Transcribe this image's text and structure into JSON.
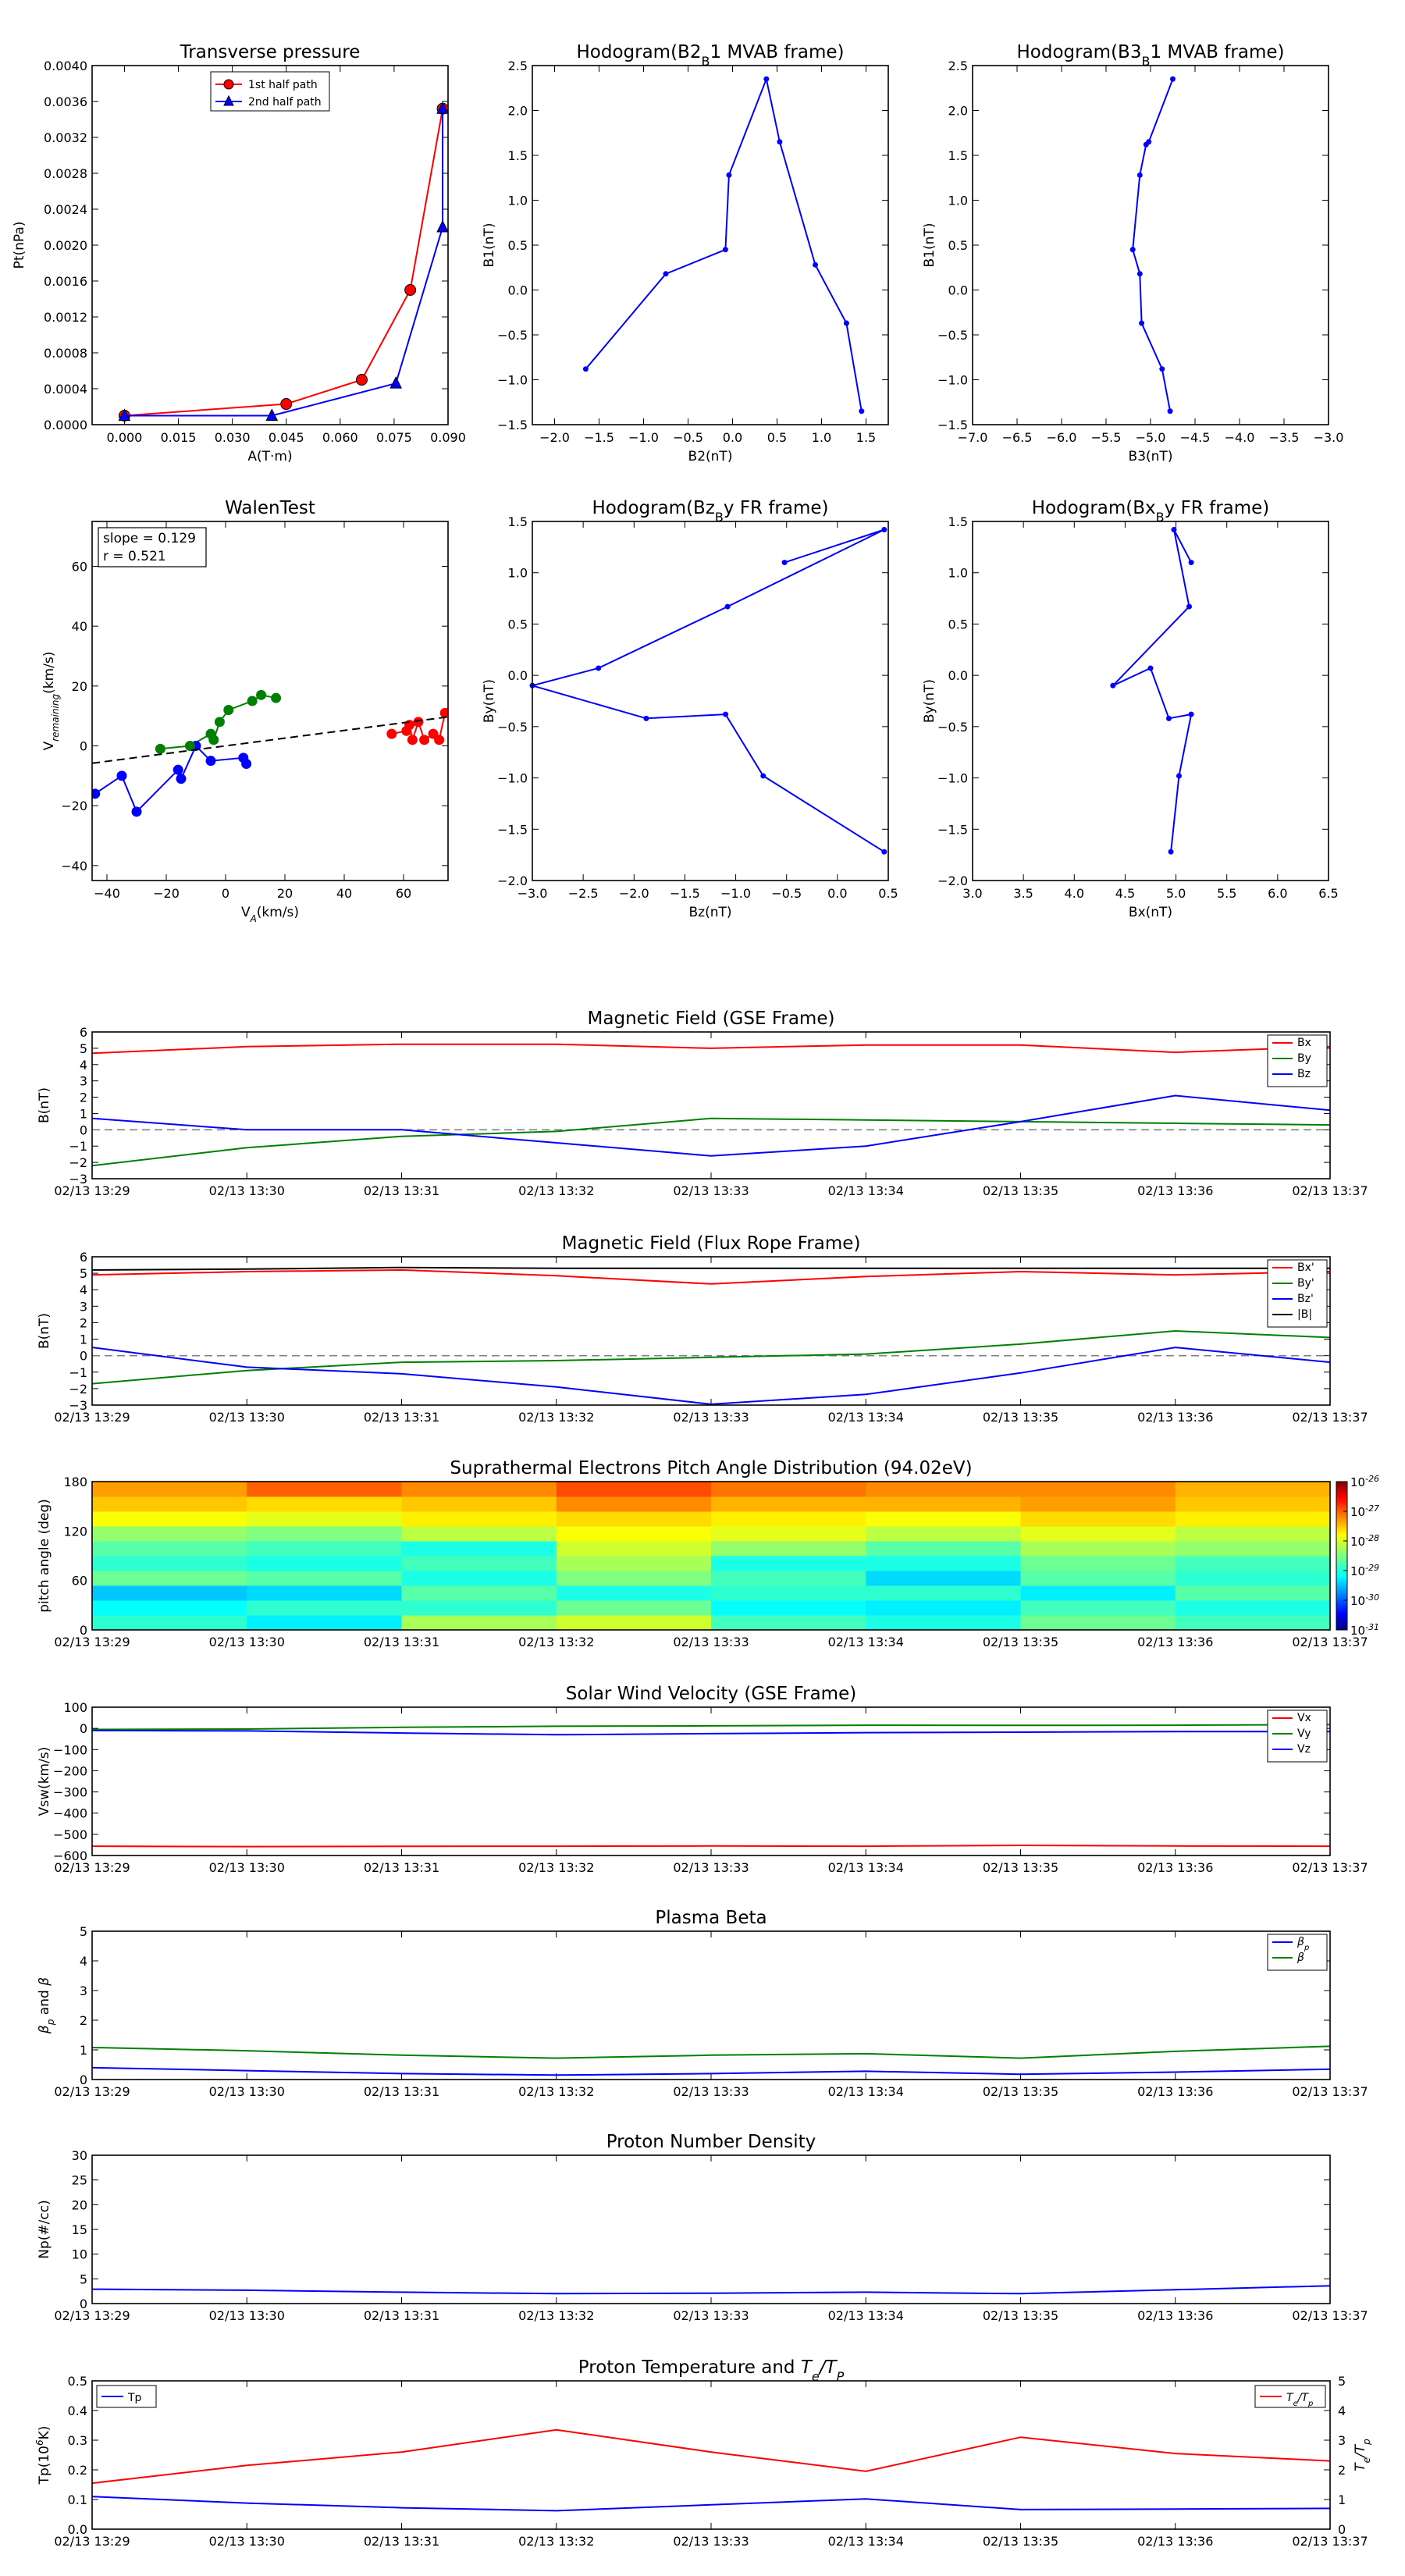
{
  "times": [
    "02/13 13:29",
    "02/13 13:30",
    "02/13 13:31",
    "02/13 13:32",
    "02/13 13:33",
    "02/13 13:34",
    "02/13 13:35",
    "02/13 13:36",
    "02/13 13:37"
  ],
  "colors": {
    "red": "#ff0000",
    "green": "#008000",
    "blue": "#0000ff",
    "black": "#000000",
    "gray": "#808080"
  },
  "chart_data": [
    {
      "id": "pt",
      "type": "line",
      "title": "Transverse pressure",
      "xlabel": "A(T·m)",
      "ylabel": "Pt(nPa)",
      "xlim": [
        -0.009,
        0.09
      ],
      "ylim": [
        0,
        0.004
      ],
      "xticks": [
        "0.000",
        "0.015",
        "0.030",
        "0.045",
        "0.060",
        "0.075",
        "0.090"
      ],
      "yticks": [
        "0.0000",
        "0.0004",
        "0.0008",
        "0.0012",
        "0.0016",
        "0.0020",
        "0.0024",
        "0.0028",
        "0.0032",
        "0.0036",
        "0.0040"
      ],
      "legend": {
        "position": "top-center",
        "entries": [
          "1st half path",
          "2nd half path"
        ]
      },
      "series": [
        {
          "name": "1st half path",
          "color": "red",
          "marker": "circle",
          "x": [
            0.0,
            0.045,
            0.066,
            0.0795,
            0.0885
          ],
          "y": [
            0.0001,
            0.00023,
            0.0005,
            0.0015,
            0.00352
          ]
        },
        {
          "name": "2nd half path",
          "color": "blue",
          "marker": "triangle",
          "x": [
            0.0,
            0.041,
            0.0755,
            0.0885,
            0.0885
          ],
          "y": [
            0.0001,
            0.0001,
            0.00046,
            0.0022,
            0.00352
          ]
        }
      ]
    },
    {
      "id": "h1",
      "type": "line",
      "title": "Hodogram(B2_B1 MVAB frame)",
      "xlabel": "B2(nT)",
      "ylabel": "B1(nT)",
      "xlim": [
        -2.25,
        1.75
      ],
      "ylim": [
        -1.5,
        2.5
      ],
      "xticks": [
        "−2.0",
        "−1.5",
        "−1.0",
        "−0.5",
        "0.0",
        "0.5",
        "1.0",
        "1.5"
      ],
      "yticks": [
        "−1.5",
        "−1.0",
        "−0.5",
        "0.0",
        "0.5",
        "1.0",
        "1.5",
        "2.0",
        "2.5"
      ],
      "series": [
        {
          "color": "blue",
          "marker": "dot",
          "x": [
            -1.65,
            -0.75,
            -0.08,
            -0.04,
            0.38,
            0.53,
            0.93,
            1.28,
            1.45
          ],
          "y": [
            -0.88,
            0.18,
            0.45,
            1.28,
            2.35,
            1.65,
            0.28,
            -0.37,
            -1.35
          ]
        }
      ]
    },
    {
      "id": "h2",
      "type": "line",
      "title": "Hodogram(B3_B1 MVAB frame)",
      "xlabel": "B3(nT)",
      "ylabel": "B1(nT)",
      "xlim": [
        -7.0,
        -3.0
      ],
      "ylim": [
        -1.5,
        2.5
      ],
      "xticks": [
        "−7.0",
        "−6.5",
        "−6.0",
        "−5.5",
        "−5.0",
        "−4.5",
        "−4.0",
        "−3.5",
        "−3.0"
      ],
      "yticks": [
        "−1.5",
        "−1.0",
        "−0.5",
        "0.0",
        "0.5",
        "1.0",
        "1.5",
        "2.0",
        "2.5"
      ],
      "series": [
        {
          "color": "blue",
          "marker": "dot",
          "x": [
            -4.78,
            -4.87,
            -5.1,
            -5.12,
            -5.2,
            -5.12,
            -5.05,
            -5.02,
            -4.75
          ],
          "y": [
            -1.35,
            -0.88,
            -0.37,
            0.18,
            0.45,
            1.28,
            1.62,
            1.65,
            2.35
          ]
        }
      ]
    },
    {
      "id": "walen",
      "type": "scatter",
      "title": "WalenTest",
      "xlabel": "V$_A$(km/s)",
      "ylabel": "V$_{remaining}$(km/s)",
      "xlim": [
        -45,
        75
      ],
      "ylim": [
        -45,
        75
      ],
      "xticks": [
        "−40",
        "−20",
        "0",
        "20",
        "40",
        "60"
      ],
      "yticks": [
        "−40",
        "−20",
        "0",
        "20",
        "40",
        "60"
      ],
      "annotation": [
        "slope = 0.129",
        "r = 0.521"
      ],
      "fit": {
        "slope": 0.129,
        "intercept": 0.0
      },
      "series": [
        {
          "color": "blue",
          "x": [
            -44,
            -35,
            -30,
            -16,
            -15,
            -10,
            -5,
            6,
            7
          ],
          "y": [
            -16,
            -10,
            -22,
            -8,
            -11,
            0,
            -5,
            -4,
            -6
          ]
        },
        {
          "color": "green",
          "x": [
            -22,
            -12,
            -5,
            -4,
            -2,
            1,
            9,
            12,
            17
          ],
          "y": [
            -1,
            0,
            4,
            2,
            8,
            12,
            15,
            17,
            16
          ]
        },
        {
          "color": "red",
          "x": [
            56,
            61,
            62,
            63,
            65,
            67,
            70,
            72,
            74
          ],
          "y": [
            4,
            5,
            7,
            2,
            8,
            2,
            4,
            2,
            11
          ]
        }
      ]
    },
    {
      "id": "h3",
      "type": "line",
      "title": "Hodogram(Bz_By FR frame)",
      "xlabel": "Bz(nT)",
      "ylabel": "By(nT)",
      "xlim": [
        -3.0,
        0.5
      ],
      "ylim": [
        -2.0,
        1.5
      ],
      "xticks": [
        "−3.0",
        "−2.5",
        "−2.0",
        "−1.5",
        "−1.0",
        "−0.5",
        "0.0",
        "0.5"
      ],
      "yticks": [
        "−2.0",
        "−1.5",
        "−1.0",
        "−0.5",
        "0.0",
        "0.5",
        "1.0",
        "1.5"
      ],
      "series": [
        {
          "color": "blue",
          "marker": "dot",
          "x": [
            0.46,
            -0.73,
            -1.1,
            -1.88,
            -3.0,
            -2.35,
            -1.08,
            0.46,
            -0.52
          ],
          "y": [
            -1.72,
            -0.98,
            -0.38,
            -0.42,
            -0.1,
            0.07,
            0.67,
            1.42,
            1.1
          ]
        }
      ]
    },
    {
      "id": "h4",
      "type": "line",
      "title": "Hodogram(Bx_By FR frame)",
      "xlabel": "Bx(nT)",
      "ylabel": "By(nT)",
      "xlim": [
        3.0,
        6.5
      ],
      "ylim": [
        -2.0,
        1.5
      ],
      "xticks": [
        "3.0",
        "3.5",
        "4.0",
        "4.5",
        "5.0",
        "5.5",
        "6.0",
        "6.5"
      ],
      "yticks": [
        "−2.0",
        "−1.5",
        "−1.0",
        "−0.5",
        "0.0",
        "0.5",
        "1.0",
        "1.5"
      ],
      "series": [
        {
          "color": "blue",
          "marker": "dot",
          "x": [
            4.95,
            5.03,
            5.15,
            4.93,
            4.75,
            4.38,
            5.13,
            4.98,
            5.15
          ],
          "y": [
            -1.72,
            -0.98,
            -0.38,
            -0.42,
            0.07,
            -0.1,
            0.67,
            1.42,
            1.1
          ]
        }
      ]
    },
    {
      "id": "bgse",
      "type": "line",
      "title": "Magnetic Field (GSE Frame)",
      "ylabel": "B(nT)",
      "xlim": [
        0,
        8
      ],
      "ylim": [
        -3,
        6
      ],
      "yticks": [
        "−3",
        "−2",
        "−1",
        "0",
        "1",
        "2",
        "3",
        "4",
        "5",
        "6"
      ],
      "zero_line": true,
      "legend": {
        "position": "top-right",
        "entries": [
          "Bx",
          "By",
          "Bz"
        ]
      },
      "series": [
        {
          "name": "Bx",
          "color": "red",
          "x": [
            0,
            1,
            2,
            3,
            4,
            5,
            6,
            7,
            8
          ],
          "y": [
            4.7,
            5.1,
            5.25,
            5.25,
            5.0,
            5.2,
            5.2,
            4.75,
            5.1
          ]
        },
        {
          "name": "By",
          "color": "green",
          "x": [
            0,
            1,
            2,
            3,
            4,
            5,
            6,
            7,
            8
          ],
          "y": [
            -2.2,
            -1.1,
            -0.4,
            -0.1,
            0.7,
            0.6,
            0.5,
            0.4,
            0.3
          ]
        },
        {
          "name": "Bz",
          "color": "blue",
          "x": [
            0,
            1,
            2,
            3,
            4,
            5,
            6,
            7,
            8
          ],
          "y": [
            0.7,
            0.0,
            0.0,
            -0.8,
            -1.6,
            -1.0,
            0.5,
            2.1,
            1.2
          ]
        }
      ]
    },
    {
      "id": "bfr",
      "type": "line",
      "title": "Magnetic Field (Flux Rope Frame)",
      "ylabel": "B(nT)",
      "xlim": [
        0,
        8
      ],
      "ylim": [
        -3,
        6
      ],
      "yticks": [
        "−3",
        "−2",
        "−1",
        "0",
        "1",
        "2",
        "3",
        "4",
        "5",
        "6"
      ],
      "zero_line": true,
      "legend": {
        "position": "top-right",
        "entries": [
          "Bx'",
          "By'",
          "Bz'",
          "|B|"
        ]
      },
      "series": [
        {
          "name": "Bx'",
          "color": "red",
          "x": [
            0,
            1,
            2,
            3,
            4,
            5,
            6,
            7,
            8
          ],
          "y": [
            4.9,
            5.1,
            5.2,
            4.85,
            4.35,
            4.8,
            5.1,
            4.9,
            5.1
          ]
        },
        {
          "name": "By'",
          "color": "green",
          "x": [
            0,
            1,
            2,
            3,
            4,
            5,
            6,
            7,
            8
          ],
          "y": [
            -1.7,
            -0.9,
            -0.4,
            -0.3,
            -0.1,
            0.1,
            0.7,
            1.5,
            1.1
          ]
        },
        {
          "name": "Bz'",
          "color": "blue",
          "x": [
            0,
            1,
            2,
            3,
            4,
            5,
            6,
            7,
            8
          ],
          "y": [
            0.5,
            -0.7,
            -1.1,
            -1.9,
            -2.95,
            -2.35,
            -1.05,
            0.5,
            -0.4
          ]
        },
        {
          "name": "|B|",
          "color": "black",
          "x": [
            0,
            1,
            2,
            3,
            4,
            5,
            6,
            7,
            8
          ],
          "y": [
            5.2,
            5.25,
            5.35,
            5.3,
            5.3,
            5.3,
            5.3,
            5.3,
            5.3
          ]
        }
      ]
    },
    {
      "id": "pad",
      "type": "heatmap",
      "title": "Suprathermal Electrons Pitch Angle Distribution (94.02eV)",
      "ylabel": "pitch angle (deg)",
      "xlim": [
        0,
        8
      ],
      "ylim": [
        0,
        180
      ],
      "yticks": [
        "0",
        "60",
        "120",
        "180"
      ],
      "colorbar": {
        "ticks": [
          "10$^{-26}$",
          "10$^{-27}$",
          "10$^{-28}$",
          "10$^{-29}$",
          "10$^{-30}$",
          "10$^{-31}$"
        ],
        "log_range": [
          -31,
          -26
        ]
      },
      "z": [
        [
          -28.9,
          -29.2,
          -28.3,
          -28.1,
          -28.8,
          -29.0,
          -28.6,
          -28.8
        ],
        [
          -29.1,
          -28.9,
          -28.9,
          -28.6,
          -29.1,
          -29.2,
          -28.8,
          -29.0
        ],
        [
          -29.4,
          -29.3,
          -28.7,
          -29.0,
          -28.9,
          -28.9,
          -29.2,
          -28.7
        ],
        [
          -28.6,
          -28.7,
          -29.0,
          -28.5,
          -28.8,
          -29.3,
          -28.7,
          -28.9
        ],
        [
          -28.9,
          -29.0,
          -28.8,
          -28.3,
          -29.0,
          -29.0,
          -28.6,
          -28.8
        ],
        [
          -28.7,
          -28.8,
          -29.0,
          -28.1,
          -28.4,
          -28.7,
          -28.3,
          -28.4
        ],
        [
          -28.4,
          -28.5,
          -28.2,
          -27.9,
          -28.0,
          -28.2,
          -28.0,
          -28.2
        ],
        [
          -27.9,
          -28.0,
          -27.8,
          -27.7,
          -27.8,
          -27.9,
          -27.7,
          -27.8
        ],
        [
          -27.6,
          -27.7,
          -27.6,
          -27.3,
          -27.5,
          -27.5,
          -27.4,
          -27.6
        ],
        [
          -27.4,
          -27.1,
          -27.3,
          -27.0,
          -27.2,
          -27.3,
          -27.3,
          -27.5
        ]
      ]
    },
    {
      "id": "vsw",
      "type": "line",
      "title": "Solar Wind Velocity (GSE Frame)",
      "ylabel": "Vsw(km/s)",
      "xlim": [
        0,
        8
      ],
      "ylim": [
        -600,
        100
      ],
      "yticks": [
        "−600",
        "−500",
        "−400",
        "−300",
        "−200",
        "−100",
        "0",
        "100"
      ],
      "legend": {
        "position": "top-right",
        "entries": [
          "Vx",
          "Vy",
          "Vz"
        ]
      },
      "series": [
        {
          "name": "Vx",
          "color": "red",
          "x": [
            0,
            1,
            2,
            3,
            4,
            5,
            6,
            7,
            8
          ],
          "y": [
            -556,
            -558,
            -557,
            -556,
            -555,
            -556,
            -552,
            -555,
            -556
          ]
        },
        {
          "name": "Vy",
          "color": "green",
          "x": [
            0,
            1,
            2,
            3,
            4,
            5,
            6,
            7,
            8
          ],
          "y": [
            -5,
            -3,
            5,
            10,
            12,
            15,
            14,
            15,
            18
          ]
        },
        {
          "name": "Vz",
          "color": "blue",
          "x": [
            0,
            1,
            2,
            3,
            4,
            5,
            6,
            7,
            8
          ],
          "y": [
            -10,
            -12,
            -22,
            -30,
            -25,
            -20,
            -18,
            -15,
            -15
          ]
        }
      ]
    },
    {
      "id": "beta",
      "type": "line",
      "title": "Plasma Beta",
      "ylabel": "$\\beta_p$ and $\\beta$",
      "xlim": [
        0,
        8
      ],
      "ylim": [
        0,
        5
      ],
      "yticks": [
        "0",
        "1",
        "2",
        "3",
        "4",
        "5"
      ],
      "legend": {
        "position": "top-right",
        "entries": [
          "$\\beta_p$",
          "$\\beta$"
        ]
      },
      "series": [
        {
          "name": "$\\beta_p$",
          "color": "blue",
          "x": [
            0,
            1,
            2,
            3,
            4,
            5,
            6,
            7,
            8
          ],
          "y": [
            0.4,
            0.3,
            0.2,
            0.15,
            0.2,
            0.28,
            0.18,
            0.25,
            0.35
          ]
        },
        {
          "name": "$\\beta$",
          "color": "green",
          "x": [
            0,
            1,
            2,
            3,
            4,
            5,
            6,
            7,
            8
          ],
          "y": [
            1.08,
            0.97,
            0.82,
            0.72,
            0.82,
            0.87,
            0.72,
            0.95,
            1.12
          ]
        }
      ]
    },
    {
      "id": "np",
      "type": "line",
      "title": "Proton Number Density",
      "ylabel": "Np(#/cc)",
      "xlim": [
        0,
        8
      ],
      "ylim": [
        0,
        30
      ],
      "yticks": [
        "0",
        "5",
        "10",
        "15",
        "20",
        "25",
        "30"
      ],
      "series": [
        {
          "color": "blue",
          "x": [
            0,
            1,
            2,
            3,
            4,
            5,
            6,
            7,
            8
          ],
          "y": [
            2.9,
            2.7,
            2.3,
            2.0,
            2.1,
            2.3,
            2.0,
            2.8,
            3.6
          ]
        }
      ]
    },
    {
      "id": "tp",
      "type": "line",
      "title": "Proton Temperature and $T_e/T_P$",
      "ylabel": "Tp(10$^6$K)",
      "ylabel_right": "$T_e/T_p$",
      "xlim": [
        0,
        8
      ],
      "ylim": [
        0,
        0.5
      ],
      "ylim_right": [
        0,
        5
      ],
      "yticks": [
        "0.0",
        "0.1",
        "0.2",
        "0.3",
        "0.4",
        "0.5"
      ],
      "yticks_right": [
        "0",
        "1",
        "2",
        "3",
        "4",
        "5"
      ],
      "legend": {
        "position": "top-left",
        "entries": [
          "Tp"
        ]
      },
      "legend_right": {
        "position": "top-right",
        "entries": [
          "$T_e/T_p$"
        ]
      },
      "series": [
        {
          "name": "Tp",
          "color": "blue",
          "axis": "left",
          "x": [
            0,
            1,
            2,
            3,
            4,
            5,
            6,
            7,
            8
          ],
          "y": [
            0.11,
            0.088,
            0.072,
            0.062,
            0.082,
            0.102,
            0.066,
            0.068,
            0.07
          ]
        },
        {
          "name": "$T_e/T_p$",
          "color": "red",
          "axis": "right",
          "x": [
            0,
            1,
            2,
            3,
            4,
            5,
            6,
            7,
            8
          ],
          "y": [
            1.55,
            2.15,
            2.6,
            3.35,
            2.6,
            1.95,
            3.1,
            2.55,
            2.3
          ]
        }
      ]
    }
  ]
}
